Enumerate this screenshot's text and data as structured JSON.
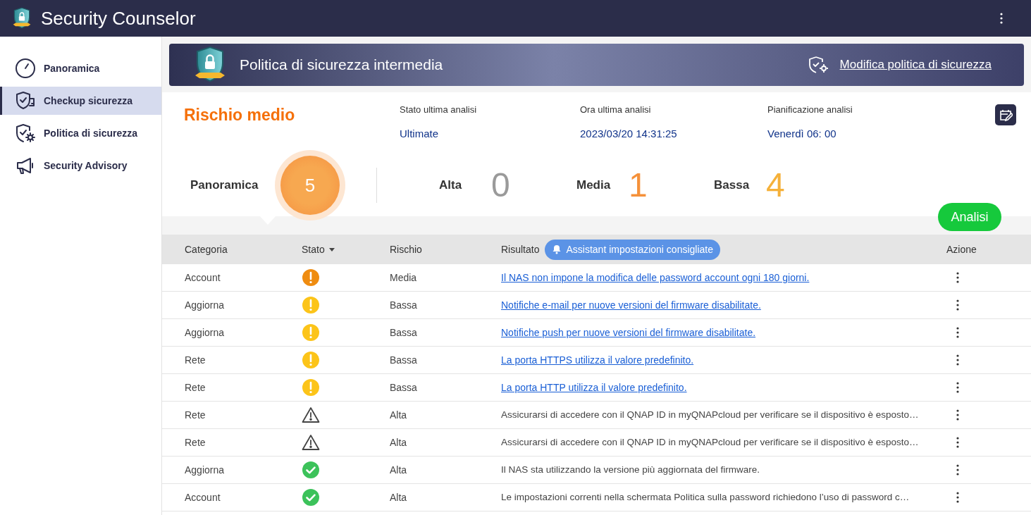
{
  "app": {
    "title": "Security Counselor"
  },
  "sidebar": {
    "items": [
      {
        "label": "Panoramica",
        "kind": "gauge",
        "selected": false
      },
      {
        "label": "Checkup sicurezza",
        "kind": "checkup",
        "selected": true
      },
      {
        "label": "Politica di sicurezza",
        "kind": "policy",
        "selected": false
      },
      {
        "label": "Security Advisory",
        "kind": "advisory",
        "selected": false
      }
    ]
  },
  "banner": {
    "title": "Politica di sicurezza intermedia",
    "link": "Modifica politica di sicurezza"
  },
  "summary": {
    "risk": "Rischio medio",
    "info": [
      {
        "label": "Stato ultima analisi",
        "value": "Ultimate"
      },
      {
        "label": "Ora ultima analisi",
        "value": "2023/03/20 14:31:25"
      },
      {
        "label": "Pianificazione analisi",
        "value": "Venerdì 06: 00"
      }
    ],
    "overview_label": "Panoramica",
    "total": "5",
    "counts": [
      {
        "label": "Alta",
        "value": "0",
        "color": "#9a9a9a"
      },
      {
        "label": "Media",
        "value": "1",
        "color": "#f5913a"
      },
      {
        "label": "Bassa",
        "value": "4",
        "color": "#f5b13a"
      }
    ],
    "scan_button": "Analisi"
  },
  "table": {
    "columns": [
      "Categoria",
      "Stato",
      "Rischio",
      "Risultato",
      "Azione"
    ],
    "assistant_button": "Assistant impostazioni consigliate",
    "rows": [
      {
        "category": "Account",
        "kind": "medium",
        "risk": "Media",
        "result": "Il NAS non impone la modifica delle password account ogni 180 giorni.",
        "link": true
      },
      {
        "category": "Aggiorna",
        "kind": "low",
        "risk": "Bassa",
        "result": "Notifiche e-mail per nuove versioni del firmware disabilitate.",
        "link": true
      },
      {
        "category": "Aggiorna",
        "kind": "low",
        "risk": "Bassa",
        "result": "Notifiche push per nuove versioni del firmware disabilitate.",
        "link": true
      },
      {
        "category": "Rete",
        "kind": "low",
        "risk": "Bassa",
        "result": "La porta HTTPS utilizza il valore predefinito.",
        "link": true
      },
      {
        "category": "Rete",
        "kind": "low",
        "risk": "Bassa",
        "result": "La porta HTTP utilizza il valore predefinito.",
        "link": true
      },
      {
        "category": "Rete",
        "kind": "warning",
        "risk": "Alta",
        "result": "Assicurarsi di accedere con il QNAP ID in myQNAPcloud per verificare se il dispositivo è esposto…",
        "link": false
      },
      {
        "category": "Rete",
        "kind": "warning",
        "risk": "Alta",
        "result": "Assicurarsi di accedere con il QNAP ID in myQNAPcloud per verificare se il dispositivo è esposto…",
        "link": false
      },
      {
        "category": "Aggiorna",
        "kind": "ok",
        "risk": "Alta",
        "result": "Il NAS sta utilizzando la versione più aggiornata del firmware.",
        "link": false
      },
      {
        "category": "Account",
        "kind": "ok",
        "risk": "Alta",
        "result": "Le impostazioni correnti nella schermata Politica sulla password richiedono l’uso di password c…",
        "link": false
      }
    ]
  }
}
